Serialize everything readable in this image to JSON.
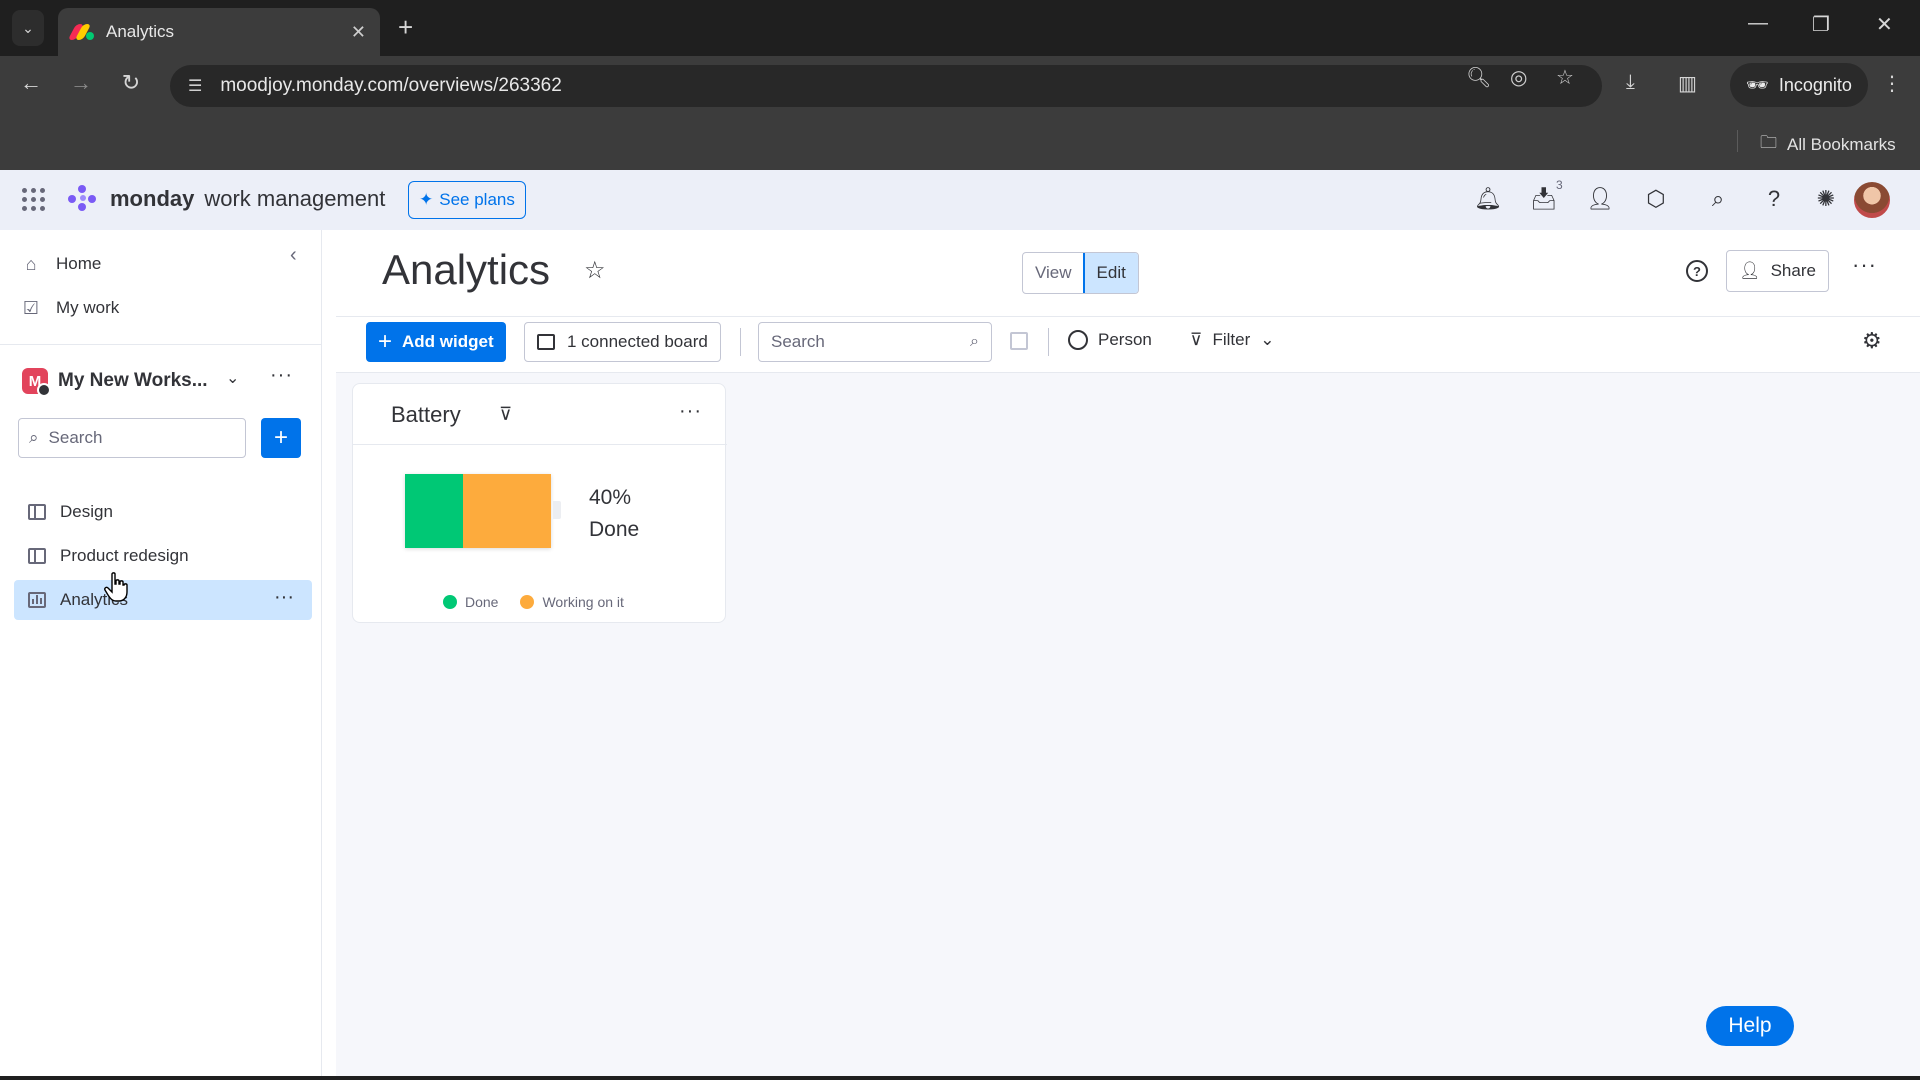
{
  "browser": {
    "tab_title": "Analytics",
    "url": "moodjoy.monday.com/overviews/263362",
    "incognito_label": "Incognito",
    "bookmarks_label": "All Bookmarks"
  },
  "app": {
    "brand": "monday",
    "brand_sub": "work management",
    "see_plans": "See plans",
    "inbox_badge": "3"
  },
  "sidebar": {
    "home": "Home",
    "my_work": "My work",
    "workspace_name": "My New Works...",
    "workspace_initial": "M",
    "search_placeholder": "Search",
    "boards": [
      {
        "label": "Design",
        "icon": "board-icon"
      },
      {
        "label": "Product redesign",
        "icon": "board-icon"
      },
      {
        "label": "Analytics",
        "icon": "dashboard-icon",
        "active": true
      }
    ]
  },
  "main": {
    "title": "Analytics",
    "view_label": "View",
    "edit_label": "Edit",
    "share_label": "Share",
    "add_widget": "Add widget",
    "connected_boards": "1 connected board",
    "search_placeholder": "Search",
    "person_label": "Person",
    "filter_label": "Filter"
  },
  "widget": {
    "title": "Battery",
    "percent": "40%",
    "percent_label": "Done",
    "segments": [
      {
        "label": "Done",
        "fraction": 0.4,
        "color": "#00c875"
      },
      {
        "label": "Working on it",
        "fraction": 0.6,
        "color": "#fdab3d"
      }
    ]
  },
  "help_button": "Help",
  "colors": {
    "accent": "#0073ea",
    "done": "#00c875",
    "working": "#fdab3d"
  }
}
